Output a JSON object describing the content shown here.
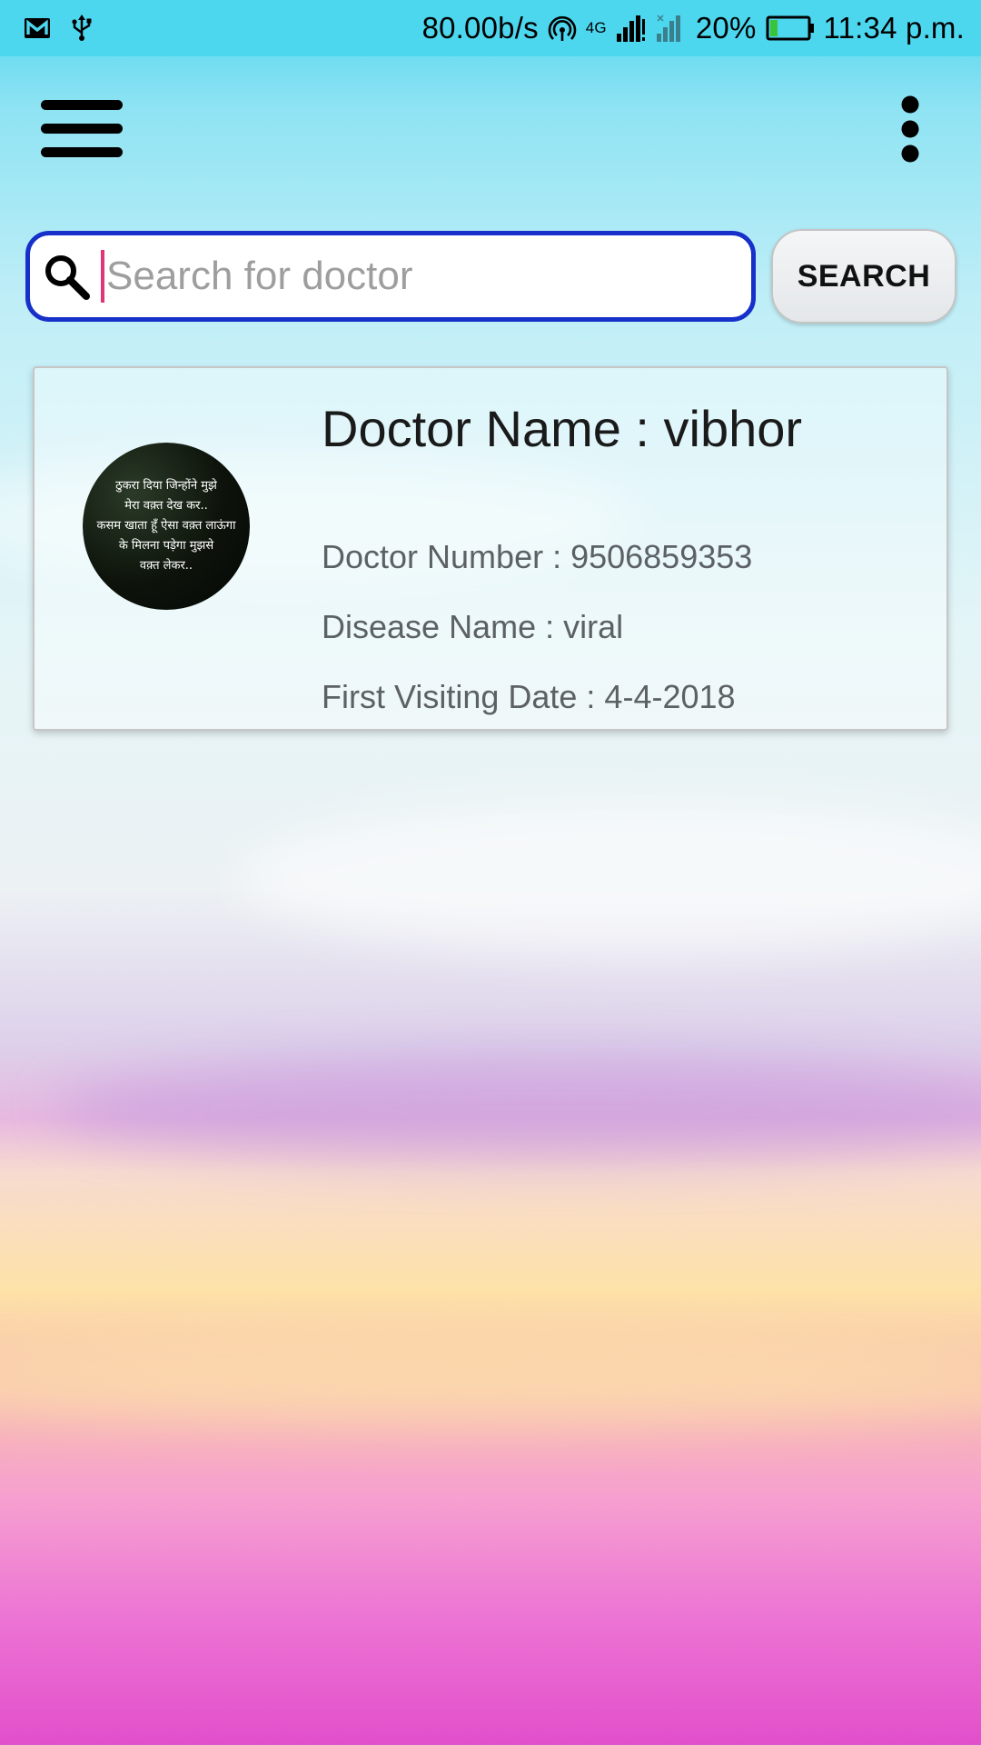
{
  "status_bar": {
    "network_speed": "80.00b/s",
    "network_type": "4G",
    "battery_percent": "20%",
    "battery_level": 0.2,
    "time": "11:34 p.m.",
    "icons": [
      "gmail-icon",
      "usb-icon",
      "hotspot-icon",
      "signal-icon",
      "signal-icon",
      "battery-icon"
    ]
  },
  "toolbar": {
    "menu_icon": "hamburger-menu-icon",
    "overflow_icon": "more-vert-icon"
  },
  "search": {
    "value": "",
    "placeholder": "Search for doctor",
    "button_label": "SEARCH",
    "focus_color": "#1630c9"
  },
  "results": [
    {
      "doctor_name": "Doctor Name : vibhor",
      "doctor_number": "Doctor Number : 9506859353",
      "disease_name": "Disease Name : viral",
      "first_visiting_date": "First Visiting Date : 4-4-2018",
      "avatar_text": "ठुकरा दिया जिन्होंने मुझे\nमेरा वक़्त देख कर..\nकसम खाता हूँ ऐसा वक़्त लाऊंगा\nके मिलना पड़ेगा मुझसे\nवक़्त लेकर.."
    }
  ]
}
